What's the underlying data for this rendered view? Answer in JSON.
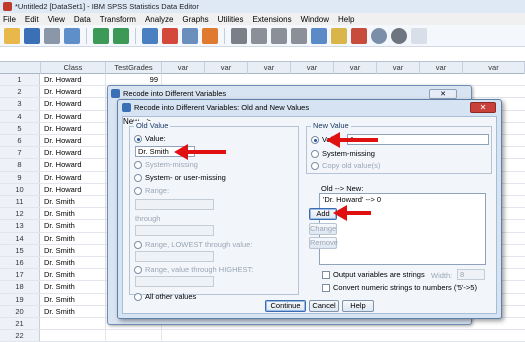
{
  "window": {
    "title": "*Untitled2 [DataSet1] - IBM SPSS Statistics Data Editor"
  },
  "menu": [
    "File",
    "Edit",
    "View",
    "Data",
    "Transform",
    "Analyze",
    "Graphs",
    "Utilities",
    "Extensions",
    "Window",
    "Help"
  ],
  "grid": {
    "headers": [
      "Class",
      "TestGrades",
      "var",
      "var",
      "var",
      "var",
      "var",
      "var",
      "var",
      "var"
    ],
    "first_testgrade": "99",
    "rows": [
      {
        "n": "1",
        "cls": "Dr. Howard"
      },
      {
        "n": "2",
        "cls": "Dr. Howard"
      },
      {
        "n": "3",
        "cls": "Dr. Howard"
      },
      {
        "n": "4",
        "cls": "Dr. Howard"
      },
      {
        "n": "5",
        "cls": "Dr. Howard"
      },
      {
        "n": "6",
        "cls": "Dr. Howard"
      },
      {
        "n": "7",
        "cls": "Dr. Howard"
      },
      {
        "n": "8",
        "cls": "Dr. Howard"
      },
      {
        "n": "9",
        "cls": "Dr. Howard"
      },
      {
        "n": "10",
        "cls": "Dr. Howard"
      },
      {
        "n": "11",
        "cls": "Dr. Smith"
      },
      {
        "n": "12",
        "cls": "Dr. Smith"
      },
      {
        "n": "13",
        "cls": "Dr. Smith"
      },
      {
        "n": "14",
        "cls": "Dr. Smith"
      },
      {
        "n": "15",
        "cls": "Dr. Smith"
      },
      {
        "n": "16",
        "cls": "Dr. Smith"
      },
      {
        "n": "17",
        "cls": "Dr. Smith"
      },
      {
        "n": "18",
        "cls": "Dr. Smith"
      },
      {
        "n": "19",
        "cls": "Dr. Smith"
      },
      {
        "n": "20",
        "cls": "Dr. Smith"
      },
      {
        "n": "21",
        "cls": ""
      },
      {
        "n": "22",
        "cls": ""
      }
    ]
  },
  "back_dialog": {
    "title": "Recode into Different Variables"
  },
  "dialog": {
    "title": "Recode into Different Variables: Old and New Values",
    "old_value": {
      "group_label": "Old Value",
      "value_label": "Value:",
      "value": "Dr. Smith",
      "system_missing": "System-missing",
      "system_or_user_missing": "System- or user-missing",
      "range": "Range:",
      "through": "through",
      "range_lowest": "Range, LOWEST through value:",
      "range_highest": "Range, value through HIGHEST:",
      "all_other": "All other values"
    },
    "new_value": {
      "group_label": "New Value",
      "value_label": "Value:",
      "value": "1",
      "system_missing": "System-missing",
      "copy_old": "Copy old value(s)"
    },
    "old_new": {
      "label": "Old --> New:",
      "items": [
        "'Dr. Howard' --> 0"
      ]
    },
    "buttons": {
      "add": "Add",
      "change": "Change",
      "remove": "Remove",
      "continue": "Continue",
      "cancel": "Cancel",
      "help": "Help"
    },
    "output_strings": "Output variables are strings",
    "width_label": "Width:",
    "width_value": "8",
    "convert_numeric": "Convert numeric strings to numbers ('5'->5)"
  }
}
